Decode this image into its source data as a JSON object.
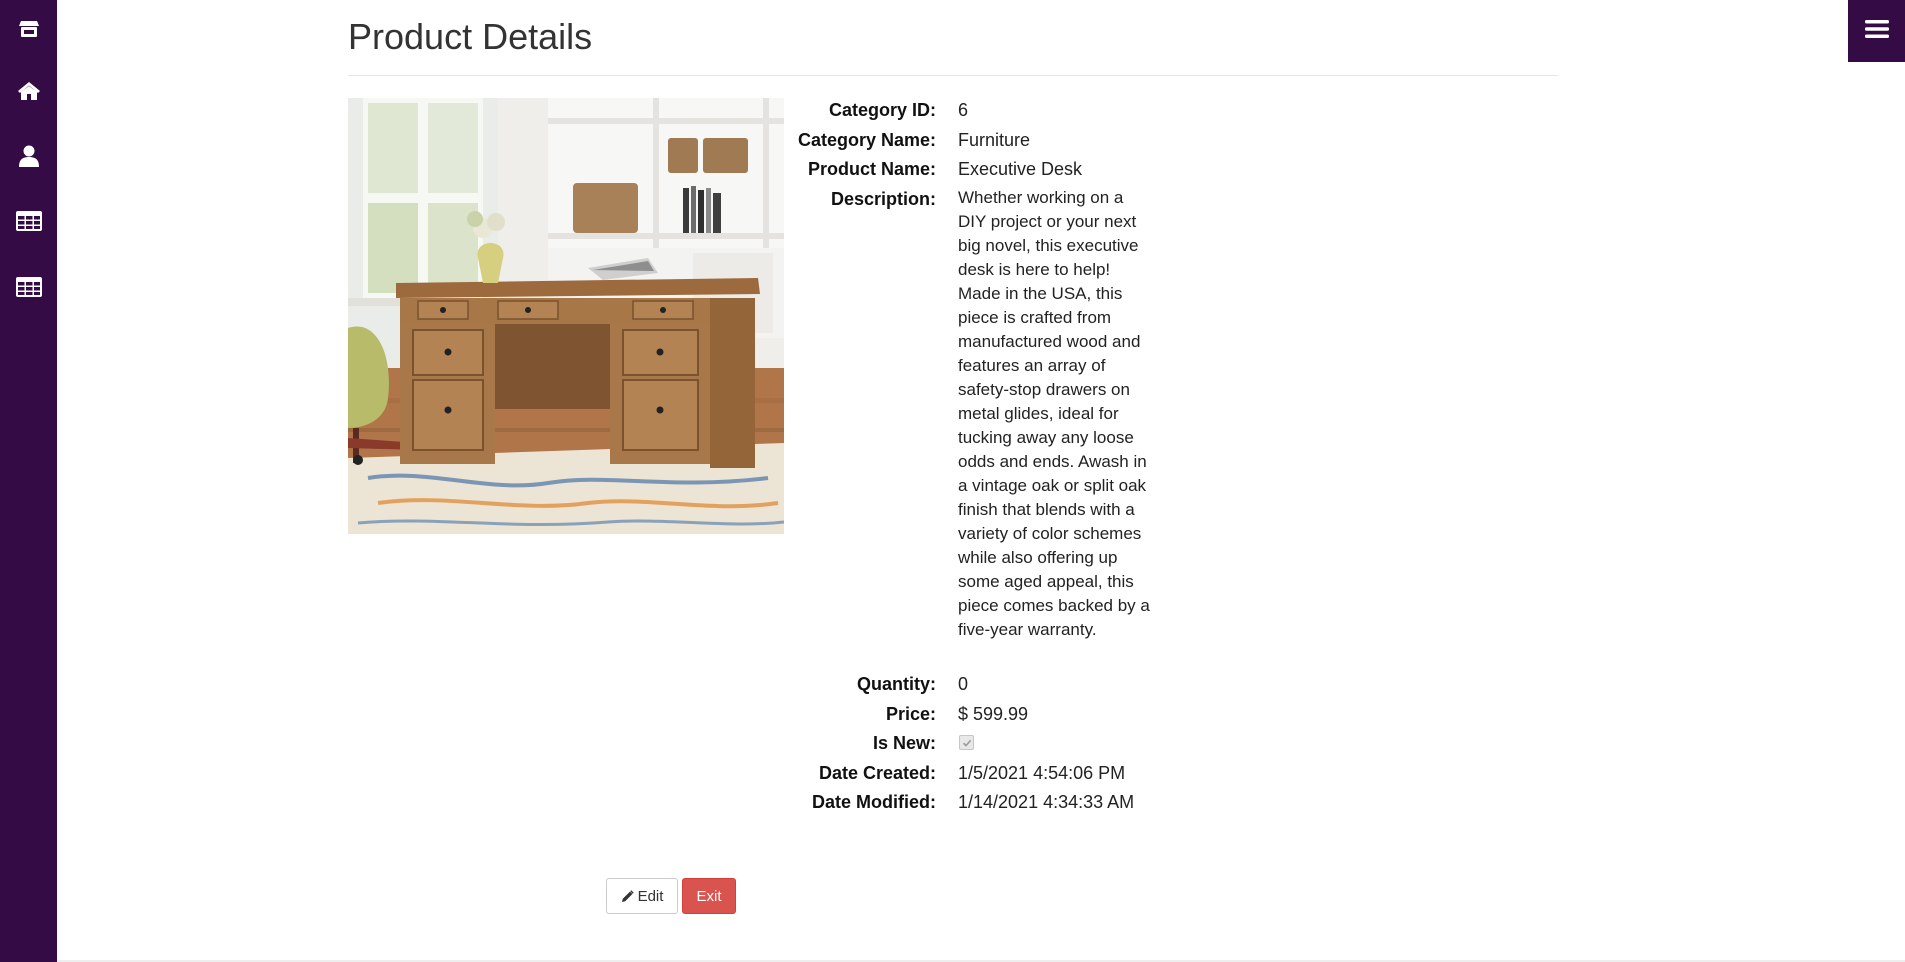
{
  "sidebar": {
    "items": [
      {
        "icon": "store-icon"
      },
      {
        "icon": "home-icon"
      },
      {
        "icon": "user-icon"
      },
      {
        "icon": "table-icon"
      },
      {
        "icon": "table-icon"
      }
    ]
  },
  "header": {
    "title": "Product Details",
    "menu_icon": "hamburger-icon"
  },
  "product": {
    "image_alt": "executive desk photo",
    "fields": {
      "category_id": {
        "label": "Category ID:",
        "value": "6"
      },
      "category_name": {
        "label": "Category Name:",
        "value": "Furniture"
      },
      "product_name": {
        "label": "Product Name:",
        "value": "Executive Desk"
      },
      "description": {
        "label": "Description:",
        "value": "Whether working on a DIY project or your next big novel, this executive desk is here to help! Made in the USA, this piece is crafted from manufactured wood and features an array of safety-stop drawers on metal glides, ideal for tucking away any loose odds and ends. Awash in a vintage oak or split oak finish that blends with a variety of color schemes while also offering up some aged appeal, this piece comes backed by a five-year warranty."
      },
      "quantity": {
        "label": "Quantity:",
        "value": "0"
      },
      "price": {
        "label": "Price:",
        "value": "$ 599.99"
      },
      "is_new": {
        "label": "Is New:",
        "checked": true
      },
      "date_created": {
        "label": "Date Created:",
        "value": "1/5/2021 4:54:06 PM"
      },
      "date_modified": {
        "label": "Date Modified:",
        "value": "1/14/2021 4:34:33 AM"
      }
    }
  },
  "actions": {
    "edit_label": "Edit",
    "exit_label": "Exit"
  },
  "colors": {
    "sidebar": "#340b45",
    "exit_button": "#d9534f"
  }
}
